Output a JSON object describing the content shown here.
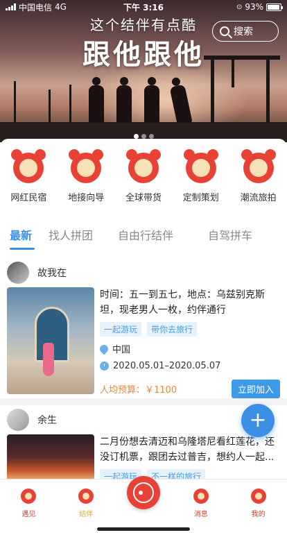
{
  "status_bar": {
    "carrier": "中国电信",
    "network": "4G",
    "time": "下午 3:16",
    "battery": "93%",
    "battery_level": 0.93
  },
  "banner": {
    "subtitle": "这个结伴有点酷",
    "title": "跟他跟他",
    "search_label": "搜索",
    "slide_count": 3,
    "active_slide": 0
  },
  "categories": [
    {
      "label": "网红民宿",
      "icon": "homestay-icon"
    },
    {
      "label": "地接向导",
      "icon": "guide-icon"
    },
    {
      "label": "全球带货",
      "icon": "shopping-icon"
    },
    {
      "label": "定制策划",
      "icon": "planning-icon"
    },
    {
      "label": "潮流旅拍",
      "icon": "photo-icon"
    }
  ],
  "tabs": [
    {
      "label": "最新",
      "active": true
    },
    {
      "label": "找人拼团",
      "active": false
    },
    {
      "label": "自由行结伴",
      "active": false
    },
    {
      "label": "自驾拼车",
      "active": false
    }
  ],
  "posts": [
    {
      "author": "故我在",
      "title": "时间：五一到五七，地点：乌兹别克斯坦，现老男人一枚，约伴通行",
      "tags": [
        "一起游玩",
        "带你去旅行"
      ],
      "location": "中国",
      "date_range": "2020.05.01–2020.05.07",
      "budget": "人均预算：￥1100",
      "join_label": "立即加入"
    },
    {
      "author": "余生",
      "title": "二月份想去清迈和乌隆塔尼看红莲花，还没订机票，跟团去过普吉，想约人一起...",
      "tags": [
        "一起游玩",
        "不一样的旅行"
      ]
    }
  ],
  "fab_label": "+",
  "tabbar": [
    {
      "label": "遇见",
      "icon": "meet-icon"
    },
    {
      "label": "结伴",
      "icon": "companion-icon"
    },
    {
      "label": "",
      "icon": "camera-icon"
    },
    {
      "label": "消息",
      "icon": "message-icon"
    },
    {
      "label": "我的",
      "icon": "profile-icon"
    }
  ],
  "colors": {
    "accent": "#3d8ee5",
    "brand_red": "#e84236",
    "budget_orange": "#e8863a"
  }
}
